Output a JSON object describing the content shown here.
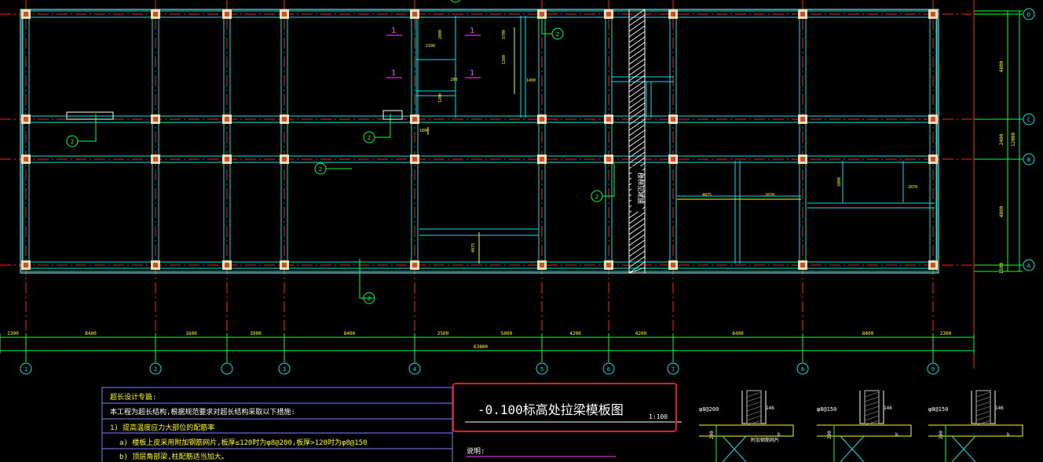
{
  "drawing": {
    "title": "-0.100标高处拉梁模板图",
    "scale": "1:100",
    "total_dim": "63800",
    "axis_bubbles": [
      "1",
      "2",
      "3",
      "4",
      "5",
      "6",
      "7",
      "8",
      "9"
    ],
    "row_bubbles": [
      "D",
      "C",
      "B",
      "A"
    ],
    "bottom_dims": [
      "2300",
      "8400",
      "1600",
      "3900",
      "8400",
      "2500",
      "5000",
      "4200",
      "4200",
      "8400",
      "8400",
      "2300"
    ],
    "right_dims": [
      "4800",
      "2400",
      "12000",
      "4800",
      "1500"
    ],
    "note_header": "超长设计专篇:",
    "note_line1": "本工程为超长结构,根据规范要求对超长结构采取以下措施:",
    "note_line2": "1) 提高温度应力大部位的配筋率",
    "note_line3": "a) 楼板上皮采用附加钢筋网片,板厚≤120时为φ8@200,板厚>120时为φ8@150",
    "note_line4": "b) 顶层角部梁,柱配筋适当加大。",
    "remark_label": "说明:",
    "detail1": "φ8@200",
    "detail2": "φ8@150",
    "detail3": "φ8@150",
    "detail_dim": "146",
    "detail_h": "200",
    "detail_b": "b",
    "detail_note": "附加钢筋网片",
    "section_tag": "1",
    "callout_tag": "2",
    "stair_label": "楼梯见建施",
    "misc_dims": [
      "2100",
      "2000",
      "200",
      "1200",
      "1800",
      "1400",
      "3700",
      "1200",
      "4075",
      "4075",
      "2670",
      "2000",
      "2870"
    ]
  },
  "colors": {
    "background": "#000000",
    "beam": "#00e5e5",
    "axis": "#ff2020",
    "dim": "#00ff40",
    "column": "#f5dcb0",
    "column_core": "#c85030",
    "magenta": "#ff40ff",
    "yellow": "#ffff00",
    "highlight": "#e02020"
  }
}
